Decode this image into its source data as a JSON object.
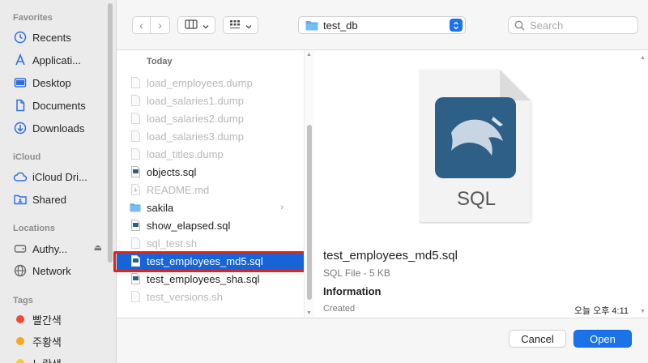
{
  "sidebar": {
    "sections": {
      "favorites": "Favorites",
      "icloud": "iCloud",
      "locations": "Locations",
      "tags": "Tags"
    },
    "favorites": [
      {
        "label": "Recents",
        "icon": "clock-icon"
      },
      {
        "label": "Applicati...",
        "icon": "applications-icon"
      },
      {
        "label": "Desktop",
        "icon": "desktop-icon"
      },
      {
        "label": "Documents",
        "icon": "document-icon"
      },
      {
        "label": "Downloads",
        "icon": "download-icon"
      }
    ],
    "icloud": [
      {
        "label": "iCloud Dri...",
        "icon": "cloud-icon"
      },
      {
        "label": "Shared",
        "icon": "shared-folder-icon"
      }
    ],
    "locations": [
      {
        "label": "Authy...",
        "icon": "disk-icon",
        "eject": "⏏"
      },
      {
        "label": "Network",
        "icon": "globe-icon"
      }
    ],
    "tags": [
      {
        "label": "빨간색",
        "color": "#f04a38"
      },
      {
        "label": "주황색",
        "color": "#f6a623"
      },
      {
        "label": "노란색",
        "color": "#f5d127"
      }
    ]
  },
  "toolbar": {
    "back_label": "‹",
    "forward_label": "›",
    "location": "test_db",
    "search_placeholder": "Search"
  },
  "file_list": {
    "group_header": "Today",
    "files": [
      {
        "name": "load_employees.dump",
        "enabled": false,
        "kind": "generic"
      },
      {
        "name": "load_salaries1.dump",
        "enabled": false,
        "kind": "generic"
      },
      {
        "name": "load_salaries2.dump",
        "enabled": false,
        "kind": "generic"
      },
      {
        "name": "load_salaries3.dump",
        "enabled": false,
        "kind": "generic"
      },
      {
        "name": "load_titles.dump",
        "enabled": false,
        "kind": "generic"
      },
      {
        "name": "objects.sql",
        "enabled": true,
        "kind": "sql"
      },
      {
        "name": "README.md",
        "enabled": false,
        "kind": "md"
      },
      {
        "name": "sakila",
        "enabled": true,
        "kind": "folder"
      },
      {
        "name": "show_elapsed.sql",
        "enabled": true,
        "kind": "sql"
      },
      {
        "name": "sql_test.sh",
        "enabled": false,
        "kind": "generic"
      },
      {
        "name": "test_employees_md5.sql",
        "enabled": true,
        "kind": "sql",
        "selected": true
      },
      {
        "name": "test_employees_sha.sql",
        "enabled": true,
        "kind": "sql"
      },
      {
        "name": "test_versions.sh",
        "enabled": false,
        "kind": "generic"
      }
    ]
  },
  "preview": {
    "icon_label": "SQL",
    "file_name": "test_employees_md5.sql",
    "file_kind": "SQL File - 5 KB",
    "info_heading": "Information",
    "created_label": "Created",
    "created_value": "오늘 오후 4:11"
  },
  "buttons": {
    "cancel": "Cancel",
    "open": "Open"
  },
  "colors": {
    "accent": "#1a73e8",
    "selection": "#1764d6",
    "highlight_outline": "#e2231a"
  }
}
